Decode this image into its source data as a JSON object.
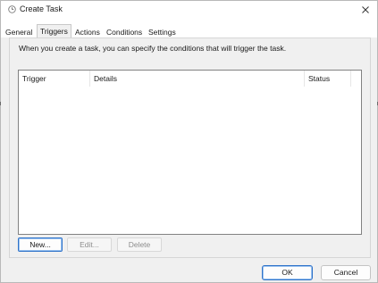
{
  "window": {
    "title": "Create Task"
  },
  "tabs": [
    {
      "label": "General",
      "active": false
    },
    {
      "label": "Triggers",
      "active": true
    },
    {
      "label": "Actions",
      "active": false
    },
    {
      "label": "Conditions",
      "active": false
    },
    {
      "label": "Settings",
      "active": false
    }
  ],
  "triggers_page": {
    "intro": "When you create a task, you can specify the conditions that will trigger the task.",
    "columns": [
      "Trigger",
      "Details",
      "Status"
    ],
    "rows": [],
    "buttons": {
      "new": "New...",
      "edit": "Edit...",
      "delete": "Delete"
    }
  },
  "footer": {
    "ok": "OK",
    "cancel": "Cancel"
  },
  "icons": {
    "window_icon": "clock-icon",
    "close": "close-icon"
  },
  "colors": {
    "accent_border": "#2f73c9",
    "dialog_bg": "#f0f0f0",
    "list_bg": "#ffffff"
  }
}
